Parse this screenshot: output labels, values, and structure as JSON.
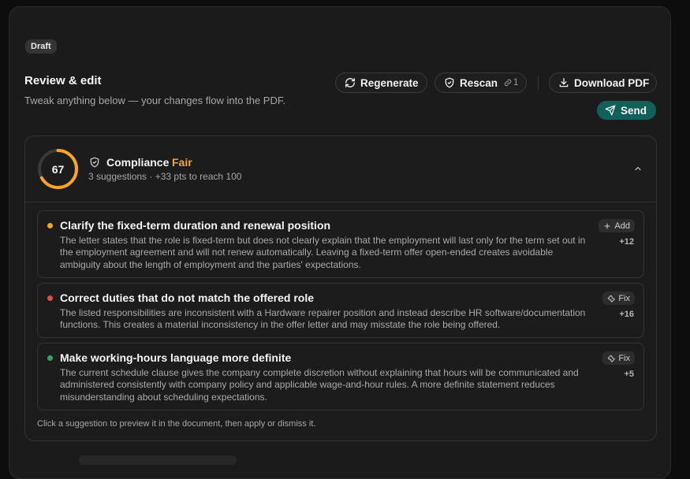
{
  "status_badge": "Draft",
  "header": {
    "title": "Review & edit",
    "subtitle": "Tweak anything below — your changes flow into the PDF."
  },
  "toolbar": {
    "regenerate_label": "Regenerate",
    "rescan_label": "Rescan",
    "rescan_count": "1",
    "download_label": "Download PDF",
    "send_label": "Send"
  },
  "compliance": {
    "score": "67",
    "score_fraction": 0.67,
    "label": "Compliance",
    "rating": "Fair",
    "rating_color": "#f5a623",
    "meta": "3 suggestions · +33 pts to reach 100"
  },
  "suggestions": [
    {
      "title": "Clarify the fixed-term duration and renewal position",
      "body": "The letter states that the role is fixed-term but does not clearly explain that the employment will last only for the term set out in the employment agreement and will not renew automatically. Leaving a fixed-term offer open-ended creates avoidable ambiguity about the length of employment and the parties' expectations.",
      "action": "Add",
      "action_icon": "plus-icon",
      "points": "+12",
      "severity_color": "#f5a623"
    },
    {
      "title": "Correct duties that do not match the offered role",
      "body": "The listed responsibilities are inconsistent with a Hardware repairer position and instead describe HR software/documentation functions. This creates a material inconsistency in the offer letter and may misstate the role being offered.",
      "action": "Fix",
      "action_icon": "wrench-icon",
      "points": "+16",
      "severity_color": "#e5484d"
    },
    {
      "title": "Make working-hours language more definite",
      "body": "The current schedule clause gives the company complete discretion without explaining that hours will be communicated and administered consistently with company policy and applicable wage-and-hour rules. A more definite statement reduces misunderstanding about scheduling expectations.",
      "action": "Fix",
      "action_icon": "wrench-icon",
      "points": "+5",
      "severity_color": "#30a46c"
    }
  ],
  "footer_note": "Click a suggestion to preview it in the document, then apply or dismiss it.",
  "colors": {
    "accent_send": "#12605a",
    "panel_bg": "#1b1b1b",
    "page_bg": "#0d0d0d"
  }
}
